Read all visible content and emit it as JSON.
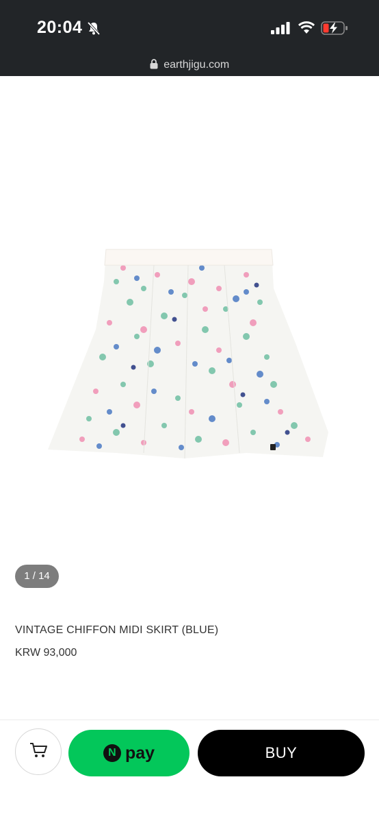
{
  "status_bar": {
    "time": "20:04",
    "url": "earthjigu.com"
  },
  "product": {
    "pager": "1 / 14",
    "name": "VINTAGE CHIFFON MIDI SKIRT (BLUE)",
    "price": "KRW 93,000"
  },
  "actions": {
    "npay_label": "pay",
    "npay_icon_letter": "N",
    "buy_label": "BUY"
  },
  "icons": [
    "bell-slash-icon",
    "signal-icon",
    "wifi-icon",
    "battery-charging-icon",
    "lock-icon",
    "cart-icon"
  ],
  "colors": {
    "status_bar_bg": "#222528",
    "npay_green": "#03c75a",
    "buy_black": "#000000",
    "pager_bg": "#7d7d7d"
  }
}
